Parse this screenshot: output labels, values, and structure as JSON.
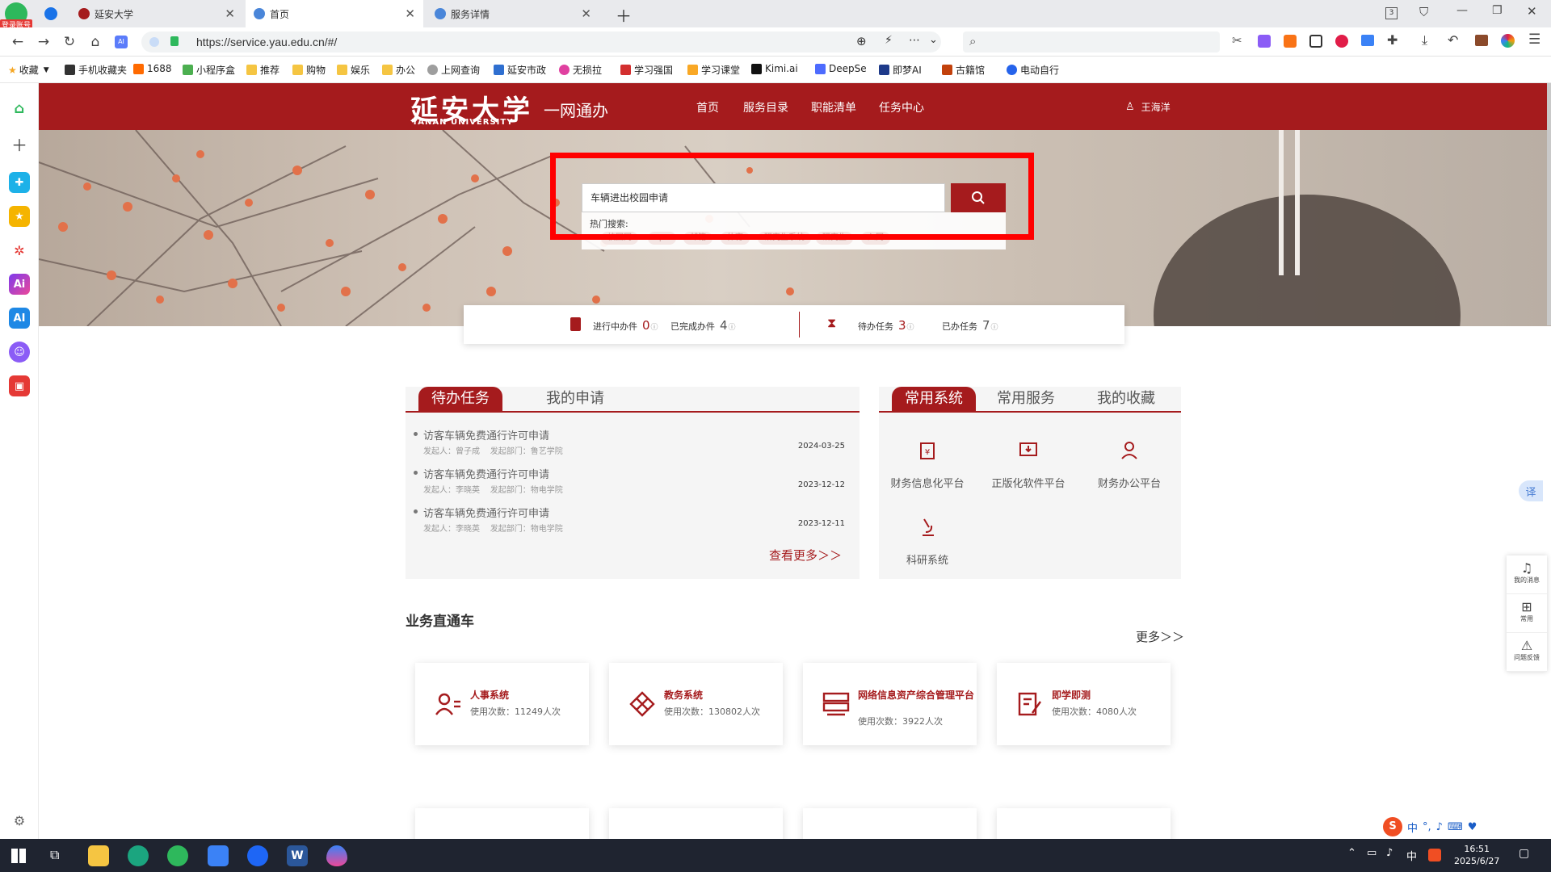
{
  "browser": {
    "login_badge": "登录账号",
    "tabs": [
      {
        "title": "延安大学",
        "active": false
      },
      {
        "title": "首页",
        "active": true
      },
      {
        "title": "服务详情",
        "active": false
      }
    ],
    "tab_count": "3",
    "url": "https://service.yau.edu.cn/#/",
    "bookmarks": [
      "收藏",
      "手机收藏夹",
      "1688",
      "小程序盒",
      "推荐",
      "购物",
      "娱乐",
      "办公",
      "上网查询",
      "延安市政",
      "无损拉",
      "学习强国",
      "学习课堂",
      "Kimi.ai",
      "DeepSe",
      "即梦AI",
      "古籍馆",
      "电动自行"
    ]
  },
  "header": {
    "logo_cn": "延安大学",
    "logo_en": "YANAN UNIVERSITY",
    "subtitle": "一网通办",
    "nav": [
      "首页",
      "服务目录",
      "职能清单",
      "任务中心"
    ],
    "user": "王海洋"
  },
  "search": {
    "value": "车辆进出校园申请",
    "hot_label": "热门搜索:",
    "hot_tags": [
      "校园网",
      "vpn",
      "邮箱",
      "体育",
      "研究生系统",
      "研究生",
      "入网"
    ]
  },
  "stats": [
    {
      "label": "进行中办件",
      "value": "0"
    },
    {
      "label": "已完成办件",
      "value": "4"
    },
    {
      "label": "待办任务",
      "value": "3"
    },
    {
      "label": "已办任务",
      "value": "7"
    }
  ],
  "tasks_panel": {
    "tabs": [
      "待办任务",
      "我的申请"
    ],
    "items": [
      {
        "title": "访客车辆免费通行许可申请",
        "initiator": "发起人：曾子成",
        "dept": "发起部门：鲁艺学院",
        "date": "2024-03-25"
      },
      {
        "title": "访客车辆免费通行许可申请",
        "initiator": "发起人：李晓英",
        "dept": "发起部门：物电学院",
        "date": "2023-12-12"
      },
      {
        "title": "访客车辆免费通行许可申请",
        "initiator": "发起人：李晓英",
        "dept": "发起部门：物电学院",
        "date": "2023-12-11"
      }
    ],
    "more": "查看更多＞＞"
  },
  "systems_panel": {
    "tabs": [
      "常用系统",
      "常用服务",
      "我的收藏"
    ],
    "items": [
      "财务信息化平台",
      "正版化软件平台",
      "财务办公平台",
      "科研系统"
    ]
  },
  "business": {
    "title": "业务直通车",
    "more": "更多＞＞",
    "cards": [
      {
        "title": "人事系统",
        "usage": "使用次数：11249人次"
      },
      {
        "title": "教务系统",
        "usage": "使用次数：130802人次"
      },
      {
        "title": "网络信息资产综合管理平台",
        "usage": "使用次数：3922人次"
      },
      {
        "title": "即学即测",
        "usage": "使用次数：4080人次"
      }
    ]
  },
  "right_float": [
    "我的消息",
    "常用",
    "问题反馈"
  ],
  "translate": "译",
  "taskbar": {
    "time": "16:51",
    "date": "2025/6/27",
    "ime": "中"
  },
  "colors": {
    "brand": "#a51b1d",
    "highlight": "#ff0000"
  }
}
